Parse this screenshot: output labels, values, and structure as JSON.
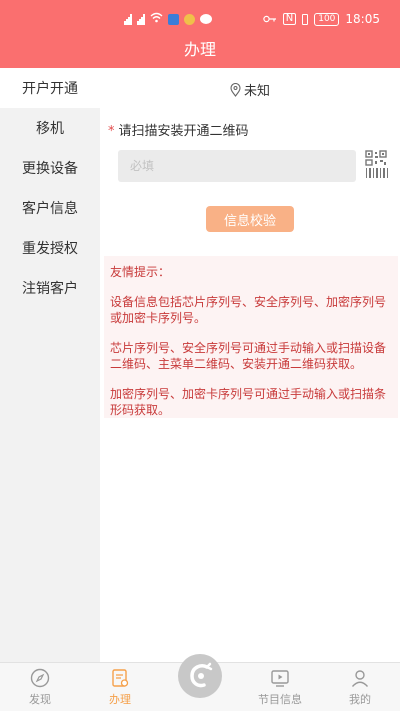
{
  "status": {
    "time": "18:05",
    "battery": "100"
  },
  "header": {
    "title": "办理"
  },
  "sidebar": {
    "items": [
      {
        "label": "开户开通",
        "active": true
      },
      {
        "label": "移机"
      },
      {
        "label": "更换设备"
      },
      {
        "label": "客户信息"
      },
      {
        "label": "重发授权"
      },
      {
        "label": "注销客户"
      }
    ]
  },
  "main": {
    "location": "未知",
    "field_label": "请扫描安装开通二维码",
    "field_required": "*",
    "input_placeholder": "必填",
    "verify_button": "信息校验",
    "tips": {
      "title": "友情提示：",
      "paragraphs": [
        "设备信息包括芯片序列号、安全序列号、加密序列号或加密卡序列号。",
        "芯片序列号、安全序列号可通过手动输入或扫描设备二维码、主菜单二维码、安装开通二维码获取。",
        "加密序列号、加密卡序列号可通过手动输入或扫描条形码获取。"
      ]
    }
  },
  "tabbar": {
    "tabs": [
      {
        "label": "发现",
        "icon": "discover-icon"
      },
      {
        "label": "办理",
        "icon": "handle-icon",
        "active": true
      },
      {
        "label": "",
        "icon": "center-logo-icon"
      },
      {
        "label": "节目信息",
        "icon": "program-icon"
      },
      {
        "label": "我的",
        "icon": "profile-icon"
      }
    ]
  },
  "colors": {
    "header": "#fa6f6f",
    "accent": "#f5a04a",
    "button": "#f9b186",
    "tip_text": "#c83a3a"
  }
}
